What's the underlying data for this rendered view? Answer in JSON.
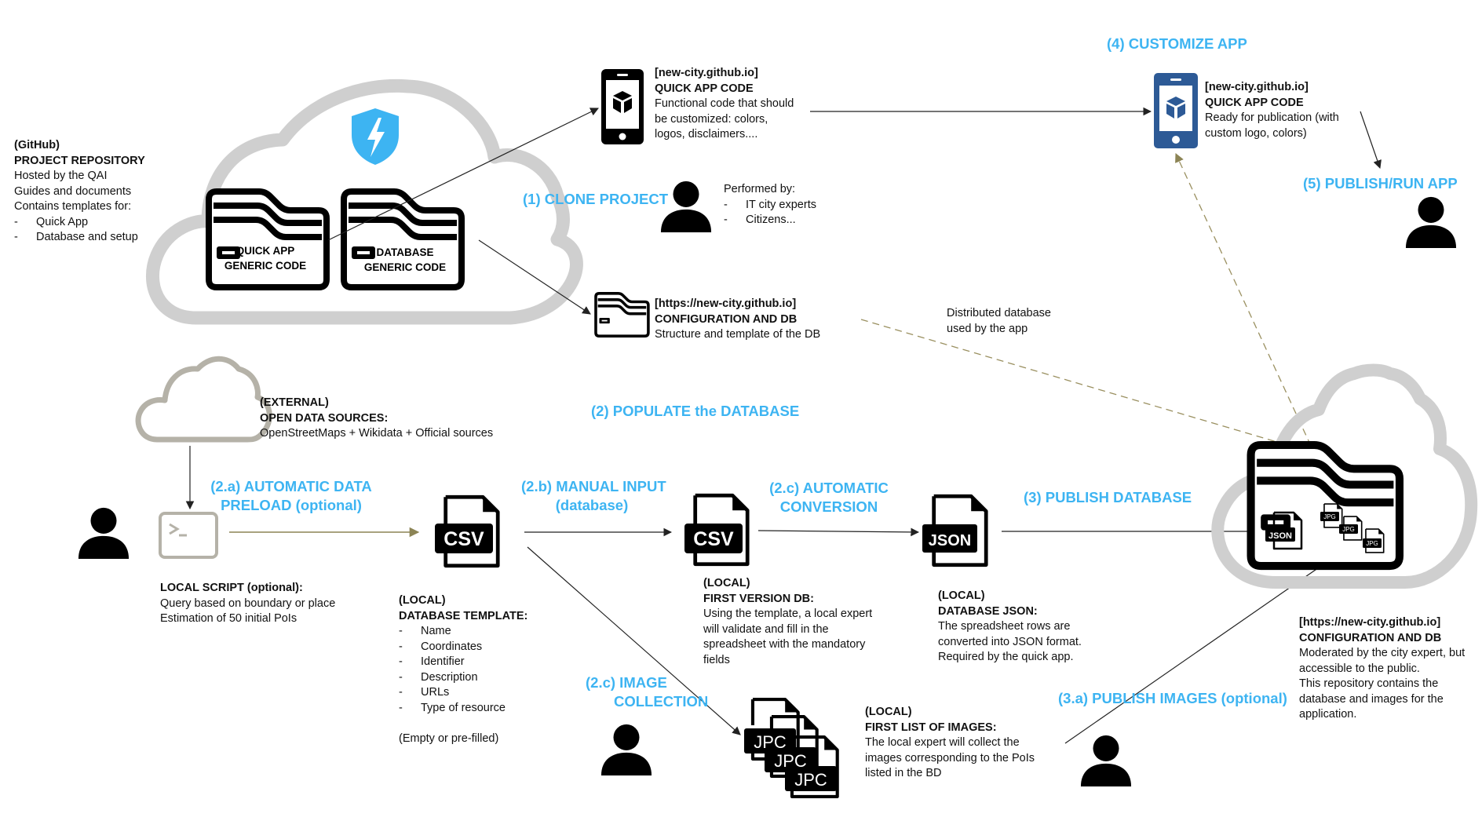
{
  "colors": {
    "step_label": "#3db4f2",
    "cloud_gray": "#cfcfcf",
    "external_cloud": "#b5b2a8",
    "dashed_arrow": "#9a9060",
    "shield_blue": "#3db4f2",
    "phone_blue": "#2d5a96",
    "icon_black": "#111111"
  },
  "github_repo": {
    "line1": "(GitHub)",
    "line2": "PROJECT REPOSITORY",
    "line3": "Hosted by the QAI",
    "line4": "Guides and documents",
    "line5": "Contains templates for:",
    "items": [
      "Quick App",
      "Database and setup"
    ]
  },
  "folders": {
    "quick_app": [
      "QUICK APP",
      "GENERIC CODE"
    ],
    "database": [
      "DATABASE",
      "GENERIC CODE"
    ]
  },
  "quick_app_code_1": {
    "url": "[new-city.github.io]",
    "title": "QUICK APP CODE",
    "desc": [
      "Functional code that should",
      "be customized: colors,",
      "logos, disclaimers...."
    ]
  },
  "performed_by": {
    "title": "Performed by:",
    "items": [
      "IT city experts",
      "Citizens..."
    ]
  },
  "config_db_1": {
    "url": "[https://new-city.github.io]",
    "title": "CONFIGURATION AND DB",
    "desc": "Structure and template of the DB"
  },
  "steps": {
    "clone": "(1) CLONE PROJECT",
    "populate": "(2) POPULATE the DATABASE",
    "preload": [
      "(2.a) AUTOMATIC DATA",
      "PRELOAD (optional)"
    ],
    "manual": [
      "(2.b) MANUAL INPUT",
      "(database)"
    ],
    "conversion": [
      "(2.c) AUTOMATIC",
      "CONVERSION"
    ],
    "image_collection": [
      "(2.c) IMAGE",
      "COLLECTION"
    ],
    "publish_db": "(3) PUBLISH DATABASE",
    "publish_images": "(3.a) PUBLISH IMAGES (optional)",
    "customize": "(4) CUSTOMIZE APP",
    "publish_run": "(5) PUBLISH/RUN APP"
  },
  "quick_app_code_2": {
    "url": "[new-city.github.io]",
    "title": "QUICK APP CODE",
    "desc": [
      "Ready for publication (with",
      "custom logo, colors)"
    ]
  },
  "distributed_db": [
    "Distributed database",
    "used by the app"
  ],
  "external": {
    "line1": "(EXTERNAL)",
    "line2": "OPEN DATA SOURCES:",
    "line3": "OpenStreetMaps + Wikidata + Official sources"
  },
  "local_script": {
    "title": "LOCAL SCRIPT (optional):",
    "lines": [
      "Query based on boundary or place",
      "Estimation of 50 initial PoIs"
    ]
  },
  "db_template": {
    "line1": "(LOCAL)",
    "title": "DATABASE TEMPLATE:",
    "items": [
      "Name",
      "Coordinates",
      "Identifier",
      "Description",
      "URLs",
      "Type of resource"
    ],
    "note": "(Empty or pre-filled)"
  },
  "first_version": {
    "line1": "(LOCAL)",
    "title": "FIRST VERSION DB:",
    "desc": [
      "Using the template, a local expert",
      "will validate and fill in the",
      "spreadsheet with the mandatory",
      "fields"
    ]
  },
  "db_json": {
    "line1": "(LOCAL)",
    "title": "DATABASE JSON:",
    "desc": [
      "The spreadsheet rows are",
      "converted into JSON format.",
      "Required by the quick app."
    ]
  },
  "images_list": {
    "line1": "(LOCAL)",
    "title": "FIRST LIST OF IMAGES:",
    "desc": [
      "The local expert will collect the",
      "images corresponding to the PoIs",
      "listed in the BD"
    ]
  },
  "config_db_2": {
    "url": "[https://new-city.github.io]",
    "title": "CONFIGURATION AND DB",
    "desc": [
      "Moderated by the city expert, but",
      "accessible to the public.",
      "This repository contains the",
      "database and images for the",
      "application."
    ]
  },
  "file_labels": {
    "csv": "CSV",
    "json": "JSON",
    "jpg": "JPG",
    "jpc": "JPC"
  }
}
